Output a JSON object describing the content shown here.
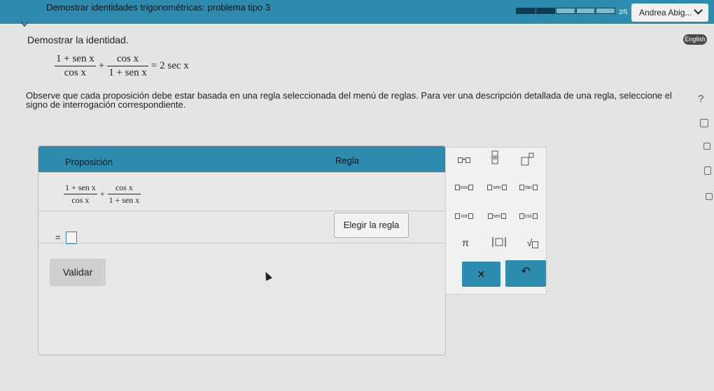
{
  "header": {
    "title": "Demostrar identidades trigonométricas: problema tipo 3",
    "progress_done": 2,
    "progress_total": 5,
    "progress_text": "2/5",
    "user_name": "Andrea Abig..."
  },
  "problem": {
    "prompt": "Demostrar la identidad.",
    "language_badge": "English",
    "identity": {
      "frac1_num": "1 + sen x",
      "frac1_den": "cos x",
      "plus": "+",
      "frac2_num": "cos x",
      "frac2_den": "1 + sen x",
      "rhs": "= 2 sec x"
    },
    "instructions": "Observe que cada proposición debe estar basada en una regla seleccionada del menú de reglas. Para ver una descripción detallada de una regla, seleccione el signo de interrogación correspondiente.",
    "help_symbol": "?"
  },
  "proof_table": {
    "col_proposition": "Proposición",
    "col_rule": "Regla",
    "row1": {
      "frac1_num": "1 + sen x",
      "frac1_den": "cos x",
      "plus": "+",
      "frac2_num": "cos x",
      "frac2_den": "1 + sen x"
    },
    "row2_equals": "=",
    "choose_rule": "Elegir la regla",
    "validate": "Validar"
  },
  "keypad": {
    "mult_dot": "•",
    "cos_label": "cos",
    "sen_label": "sen",
    "tan_label": "tan",
    "cot_label": "cot",
    "sec_label": "sec",
    "csc_label": "csc",
    "pi": "π",
    "sqrt": "√",
    "clear": "×",
    "undo": "↶"
  },
  "colors": {
    "accent": "#2d8cae",
    "background": "#e4e4e2"
  }
}
